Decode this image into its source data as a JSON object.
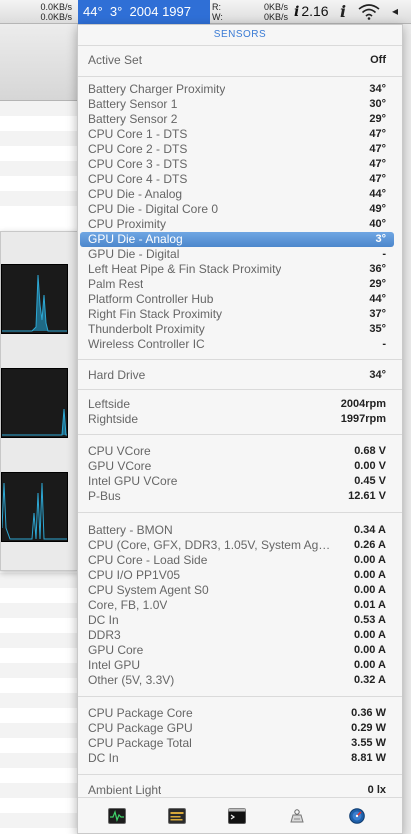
{
  "menubar": {
    "net_up": "0.0KB/s",
    "net_down": "0.0KB/s",
    "selected_item": "44°  3°  2004 1997",
    "disk_read_label": "R:",
    "disk_write_label": "W:",
    "disk_read": "0KB/s",
    "disk_write": "0KB/s",
    "load_icon": "i",
    "load_value": "2.16",
    "info_icon": "i",
    "wifi_icon": "wifi-icon",
    "arrow_icon": "◂"
  },
  "popover": {
    "title": "SENSORS",
    "active_set": {
      "label": "Active Set",
      "value": "Off"
    },
    "temperatures": [
      {
        "label": "Battery Charger Proximity",
        "value": "34°"
      },
      {
        "label": "Battery Sensor 1",
        "value": "30°"
      },
      {
        "label": "Battery Sensor 2",
        "value": "29°"
      },
      {
        "label": "CPU Core 1 - DTS",
        "value": "47°"
      },
      {
        "label": "CPU Core 2 - DTS",
        "value": "47°"
      },
      {
        "label": "CPU Core 3 - DTS",
        "value": "47°"
      },
      {
        "label": "CPU Core 4 - DTS",
        "value": "47°"
      },
      {
        "label": "CPU Die - Analog",
        "value": "44°"
      },
      {
        "label": "CPU Die - Digital Core 0",
        "value": "49°"
      },
      {
        "label": "CPU Proximity",
        "value": "40°"
      },
      {
        "label": "GPU Die - Analog",
        "value": "3°",
        "selected": true
      },
      {
        "label": "GPU Die - Digital",
        "value": "-"
      },
      {
        "label": "Left Heat Pipe & Fin Stack Proximity",
        "value": "36°"
      },
      {
        "label": "Palm Rest",
        "value": "29°"
      },
      {
        "label": "Platform Controller Hub",
        "value": "44°"
      },
      {
        "label": "Right Fin Stack Proximity",
        "value": "37°"
      },
      {
        "label": "Thunderbolt Proximity",
        "value": "35°"
      },
      {
        "label": "Wireless Controller IC",
        "value": "-"
      }
    ],
    "hard_drive": {
      "label": "Hard Drive",
      "value": "34°"
    },
    "fans": [
      {
        "label": "Leftside",
        "value": "2004rpm"
      },
      {
        "label": "Rightside",
        "value": "1997rpm"
      }
    ],
    "voltages": [
      {
        "label": "CPU VCore",
        "value": "0.68 V"
      },
      {
        "label": "GPU VCore",
        "value": "0.00 V"
      },
      {
        "label": "Intel GPU VCore",
        "value": "0.45 V"
      },
      {
        "label": "P-Bus",
        "value": "12.61 V"
      }
    ],
    "currents": [
      {
        "label": "Battery - BMON",
        "value": "0.34 A"
      },
      {
        "label": "CPU (Core, GFX, DDR3, 1.05V, System Ag…",
        "value": "0.26 A"
      },
      {
        "label": "CPU Core - Load Side",
        "value": "0.00 A"
      },
      {
        "label": "CPU I/O PP1V05",
        "value": "0.00 A"
      },
      {
        "label": "CPU System Agent S0",
        "value": "0.00 A"
      },
      {
        "label": "Core, FB, 1.0V",
        "value": "0.01 A"
      },
      {
        "label": "DC In",
        "value": "0.53 A"
      },
      {
        "label": "DDR3",
        "value": "0.00 A"
      },
      {
        "label": "GPU Core",
        "value": "0.00 A"
      },
      {
        "label": "Intel GPU",
        "value": "0.00 A"
      },
      {
        "label": "Other (5V, 3.3V)",
        "value": "0.32 A"
      }
    ],
    "power": [
      {
        "label": "CPU Package Core",
        "value": "0.36 W"
      },
      {
        "label": "CPU Package GPU",
        "value": "0.29 W"
      },
      {
        "label": "CPU Package Total",
        "value": "3.55 W"
      },
      {
        "label": "DC In",
        "value": "8.81 W"
      }
    ],
    "ambient": {
      "label": "Ambient Light",
      "value": "0 lx"
    },
    "bottom_icons": [
      "activity-monitor-icon",
      "console-icon",
      "terminal-icon",
      "system-preferences-icon",
      "disk-utility-icon"
    ]
  }
}
